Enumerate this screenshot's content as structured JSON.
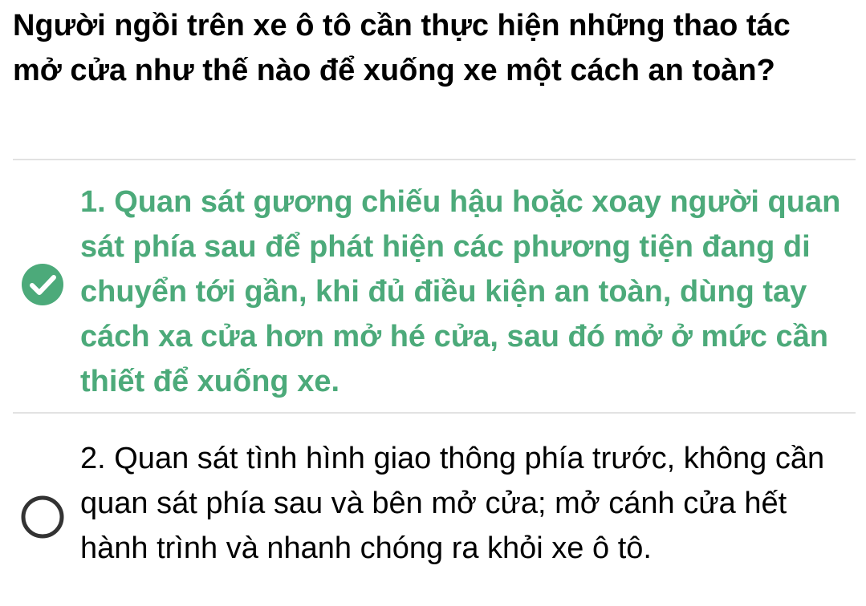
{
  "question": {
    "text": "Người ngồi trên xe ô tô cần thực hiện những thao tác mở cửa như thế nào để xuống xe một cách an toàn?"
  },
  "options": [
    {
      "text": "1. Quan sát gương chiếu hậu hoặc xoay người quan sát phía sau để phát hiện các phương tiện đang di chuyển tới gần, khi đủ điều kiện an toàn, dùng tay cách xa cửa hơn mở hé cửa, sau đó mở ở mức cần thiết để xuống xe.",
      "selected": true,
      "icon": "check-circle-icon"
    },
    {
      "text": "2. Quan sát tình hình giao thông phía trước, không cần quan sát phía sau và bên mở cửa; mở cánh cửa hết hành trình và nhanh chóng ra khỏi xe ô tô.",
      "selected": false,
      "icon": "empty-circle-icon"
    }
  ],
  "colors": {
    "correct": "#4caa7a",
    "text": "#000000",
    "divider": "#e2e2e2",
    "radio_border": "#333333"
  }
}
